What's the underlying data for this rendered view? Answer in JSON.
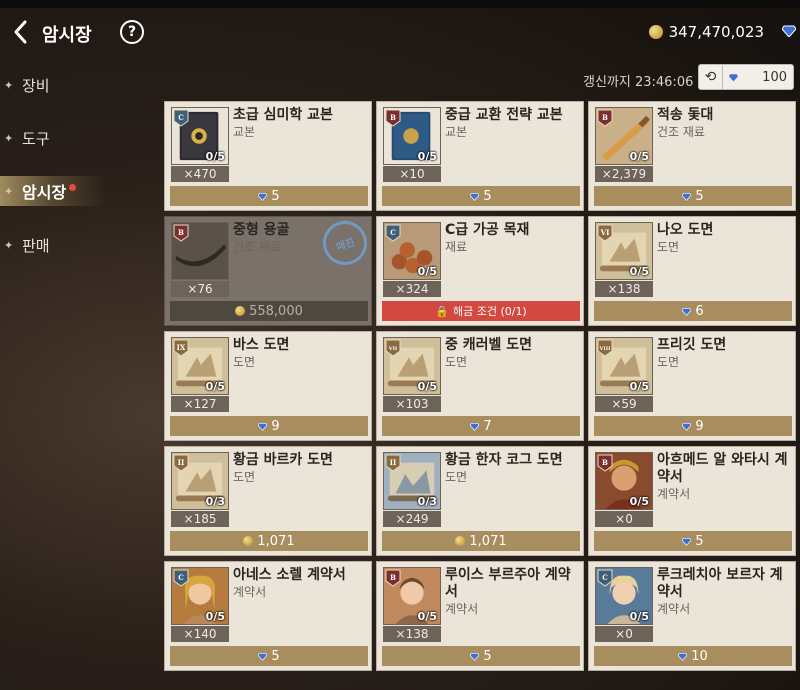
{
  "header": {
    "title": "암시장",
    "help_label": "?",
    "currency_value": "347,470,023"
  },
  "sidebar": {
    "items": [
      {
        "label": "장비"
      },
      {
        "label": "도구"
      },
      {
        "label": "암시장",
        "active": true
      },
      {
        "label": "판매"
      }
    ]
  },
  "refresh": {
    "label": "갱신까지 23:46:06",
    "cost": "100"
  },
  "colors": {
    "price_bar": "#a88d5e",
    "unlock_bar": "#d2493f",
    "card_bg": "#ebe4d9"
  },
  "cards": [
    {
      "name": "초급 심미학 교본",
      "category": "교본",
      "tier": "C",
      "stock": "0/5",
      "qty": "×470",
      "price": "5",
      "currency": "gem",
      "art": "book"
    },
    {
      "name": "중급 교환 전략 교본",
      "category": "교본",
      "tier": "B",
      "stock": "0/5",
      "qty": "×10",
      "price": "5",
      "currency": "gem",
      "art": "book2"
    },
    {
      "name": "적송 돛대",
      "category": "건조 재료",
      "tier": "B",
      "stock": "0/5",
      "qty": "×2,379",
      "price": "5",
      "currency": "gem",
      "art": "mast"
    },
    {
      "name": "중형 용골",
      "category": "건조 재료",
      "tier": "B",
      "stock": "",
      "qty": "×76",
      "price": "558,000",
      "currency": "coin",
      "art": "keel",
      "locked": true,
      "stamp": "매진"
    },
    {
      "name": "C급 가공 목재",
      "category": "재료",
      "tier": "C",
      "stock": "0/5",
      "qty": "×324",
      "price": "해금 조건 (0/1)",
      "currency": "lock",
      "art": "logs"
    },
    {
      "name": "나오 도면",
      "category": "도면",
      "tier": "VI",
      "stock": "0/5",
      "qty": "×138",
      "price": "6",
      "currency": "gem",
      "art": "scroll"
    },
    {
      "name": "바스 도면",
      "category": "도면",
      "tier": "IX",
      "stock": "0/5",
      "qty": "×127",
      "price": "9",
      "currency": "gem",
      "art": "scroll"
    },
    {
      "name": "중 캐러벨 도면",
      "category": "도면",
      "tier": "VII",
      "stock": "0/5",
      "qty": "×103",
      "price": "7",
      "currency": "gem",
      "art": "scroll"
    },
    {
      "name": "프리깃 도면",
      "category": "도면",
      "tier": "VIII",
      "stock": "0/5",
      "qty": "×59",
      "price": "9",
      "currency": "gem",
      "art": "scroll"
    },
    {
      "name": "황금 바르카 도면",
      "category": "도면",
      "tier": "II",
      "stock": "0/3",
      "qty": "×185",
      "price": "1,071",
      "currency": "coin",
      "art": "scroll"
    },
    {
      "name": "황금 한자 코그 도면",
      "category": "도면",
      "tier": "II",
      "stock": "0/3",
      "qty": "×249",
      "price": "1,071",
      "currency": "coin",
      "art": "scroll2"
    },
    {
      "name": "아흐메드 알 와타시 계약서",
      "category": "계약서",
      "tier": "B",
      "stock": "0/5",
      "qty": "×0",
      "price": "5",
      "currency": "gem",
      "art": "portrait_m"
    },
    {
      "name": "아네스 소렐 계약서",
      "category": "계약서",
      "tier": "C",
      "stock": "0/5",
      "qty": "×140",
      "price": "5",
      "currency": "gem",
      "art": "portrait_f"
    },
    {
      "name": "루이스 부르주아 계약서",
      "category": "계약서",
      "tier": "B",
      "stock": "0/5",
      "qty": "×138",
      "price": "5",
      "currency": "gem",
      "art": "portrait_f2"
    },
    {
      "name": "루크레치아 보르자 계약서",
      "category": "계약서",
      "tier": "C",
      "stock": "0/5",
      "qty": "×0",
      "price": "10",
      "currency": "gem",
      "art": "portrait_f3"
    }
  ]
}
